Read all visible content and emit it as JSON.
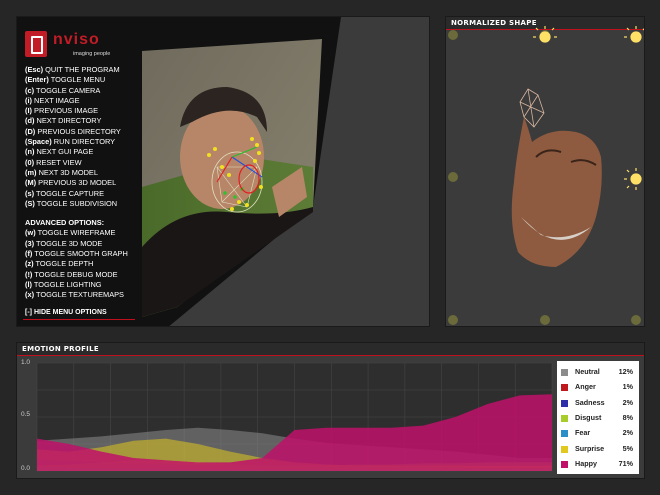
{
  "main_view": {
    "logo": {
      "word": "nviso",
      "tagline": "imaging people"
    },
    "menu": [
      {
        "key": "(Esc)",
        "label": "QUIT THE PROGRAM"
      },
      {
        "key": "(Enter)",
        "label": "TOGGLE MENU"
      },
      {
        "key": "(c)",
        "label": "TOGGLE CAMERA"
      },
      {
        "key": "(i)",
        "label": "NEXT IMAGE"
      },
      {
        "key": "(I)",
        "label": "PREVIOUS IMAGE"
      },
      {
        "key": "(d)",
        "label": "NEXT DIRECTORY"
      },
      {
        "key": "(D)",
        "label": "PREVIOUS DIRECTORY"
      },
      {
        "key": "(Space)",
        "label": "RUN DIRECTORY"
      },
      {
        "key": "(n)",
        "label": "NEXT GUI PAGE"
      },
      {
        "key": "(0)",
        "label": "RESET VIEW"
      },
      {
        "key": "(m)",
        "label": "NEXT 3D MODEL"
      },
      {
        "key": "(M)",
        "label": "PREVIOUS 3D MODEL"
      },
      {
        "key": "(s)",
        "label": "TOGGLE CAPTURE"
      },
      {
        "key": "(S)",
        "label": "TOGGLE SUBDIVISION"
      }
    ],
    "advanced_title": "ADVANCED OPTIONS:",
    "advanced": [
      {
        "key": "(w)",
        "label": "TOGGLE WIREFRAME"
      },
      {
        "key": "(3)",
        "label": "TOGGLE 3D MODE"
      },
      {
        "key": "(f)",
        "label": "TOGGLE SMOOTH GRAPH"
      },
      {
        "key": "(z)",
        "label": "TOGGLE DEPTH"
      },
      {
        "key": "(!)",
        "label": "TOGGLE DEBUG MODE"
      },
      {
        "key": "(l)",
        "label": "TOGGLE LIGHTING"
      },
      {
        "key": "(x)",
        "label": "TOGGLE TEXTUREMAPS"
      }
    ],
    "hide_menu": "[-] HIDE MENU OPTIONS"
  },
  "shape_view": {
    "title": "NORMALIZED SHAPE"
  },
  "emotion_view": {
    "title": "EMOTION PROFILE"
  },
  "chart_data": {
    "type": "area",
    "title": "EMOTION PROFILE",
    "ylim": [
      0,
      1
    ],
    "yticks": [
      "1.0",
      "0.5",
      "0.0"
    ],
    "grid": true,
    "legend_position": "right",
    "series": [
      {
        "name": "Neutral",
        "color": "#8c8c8c",
        "current": "12%",
        "values": [
          0.28,
          0.3,
          0.32,
          0.35,
          0.38,
          0.4,
          0.38,
          0.35,
          0.3,
          0.26,
          0.24,
          0.22,
          0.2,
          0.18,
          0.15,
          0.12,
          0.12
        ]
      },
      {
        "name": "Anger",
        "color": "#c0181f",
        "current": "1%",
        "values": [
          0.02,
          0.02,
          0.02,
          0.02,
          0.02,
          0.02,
          0.02,
          0.02,
          0.02,
          0.02,
          0.01,
          0.01,
          0.01,
          0.01,
          0.01,
          0.01,
          0.01
        ]
      },
      {
        "name": "Sadness",
        "color": "#2e2ea8",
        "current": "2%",
        "values": [
          0.1,
          0.09,
          0.08,
          0.07,
          0.06,
          0.05,
          0.05,
          0.05,
          0.05,
          0.04,
          0.04,
          0.03,
          0.03,
          0.03,
          0.02,
          0.02,
          0.02
        ]
      },
      {
        "name": "Disgust",
        "color": "#a8cc2a",
        "current": "8%",
        "values": [
          0.05,
          0.06,
          0.08,
          0.1,
          0.1,
          0.08,
          0.06,
          0.05,
          0.05,
          0.05,
          0.06,
          0.06,
          0.07,
          0.07,
          0.08,
          0.08,
          0.08
        ]
      },
      {
        "name": "Fear",
        "color": "#2a8fc8",
        "current": "2%",
        "values": [
          0.04,
          0.03,
          0.03,
          0.03,
          0.02,
          0.02,
          0.02,
          0.02,
          0.02,
          0.02,
          0.02,
          0.02,
          0.02,
          0.02,
          0.02,
          0.02,
          0.02
        ]
      },
      {
        "name": "Surprise",
        "color": "#e0c81e",
        "current": "5%",
        "values": [
          0.2,
          0.18,
          0.22,
          0.28,
          0.3,
          0.25,
          0.18,
          0.12,
          0.08,
          0.06,
          0.05,
          0.05,
          0.05,
          0.05,
          0.05,
          0.05,
          0.05
        ]
      },
      {
        "name": "Happy",
        "color": "#c0106a",
        "current": "71%",
        "values": [
          0.3,
          0.25,
          0.18,
          0.12,
          0.1,
          0.08,
          0.08,
          0.12,
          0.38,
          0.4,
          0.4,
          0.4,
          0.42,
          0.5,
          0.62,
          0.7,
          0.71
        ]
      }
    ]
  },
  "colors": {
    "accent": "#c0101d",
    "panel": "#3b3b3b",
    "background": "#262626"
  }
}
